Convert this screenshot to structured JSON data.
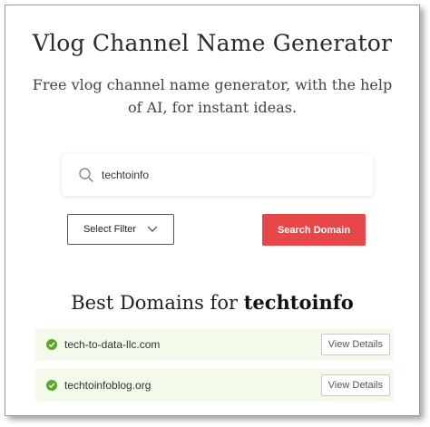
{
  "header": {
    "title": "Vlog Channel Name Generator",
    "subtitle": "Free vlog channel name generator, with the help of AI, for instant ideas."
  },
  "search": {
    "value": "techtoinfo",
    "icon": "search-icon"
  },
  "controls": {
    "filter_label": "Select Filter",
    "search_button_label": "Search Domain"
  },
  "results": {
    "heading_prefix": "Best Domains for",
    "heading_term": "techtoinfo",
    "items": [
      {
        "domain": "tech-to-data-llc.com",
        "action_label": "View Details"
      },
      {
        "domain": "techtoinfoblog.org",
        "action_label": "View Details"
      }
    ]
  },
  "colors": {
    "accent_button": "#e8474a",
    "check": "#5aa82a",
    "row_background": "#f3fae9"
  }
}
